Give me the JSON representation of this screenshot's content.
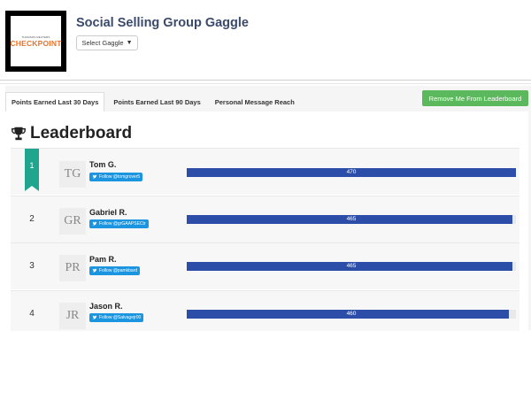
{
  "header": {
    "logo_small_text": "THOMSON REUTERS",
    "logo_main_text": "CHECKPOINT",
    "title": "Social Selling Group Gaggle",
    "select_label": "Select Gaggle"
  },
  "tabs": [
    {
      "label": "Points Earned Last 30 Days",
      "active": true
    },
    {
      "label": "Points Earned Last 90 Days",
      "active": false
    },
    {
      "label": "Personal Message Reach",
      "active": false
    }
  ],
  "remove_button_label": "Remove Me From Leaderboard",
  "leaderboard": {
    "title": "Leaderboard",
    "max_points": 470,
    "entries": [
      {
        "rank": "1",
        "initials": "TG",
        "name": "Tom G.",
        "follow": "Follow @tomgrover5",
        "points": 470,
        "points_label": "470"
      },
      {
        "rank": "2",
        "initials": "GR",
        "name": "Gabriel R.",
        "follow": "Follow @grGAAPSECtr",
        "points": 465,
        "points_label": "465"
      },
      {
        "rank": "3",
        "initials": "PR",
        "name": "Pam R.",
        "follow": "Follow @pamkbard",
        "points": 465,
        "points_label": "465"
      },
      {
        "rank": "4",
        "initials": "JR",
        "name": "Jason R.",
        "follow": "Follow @Salvagejr00",
        "points": 460,
        "points_label": "460"
      }
    ]
  },
  "colors": {
    "accent_bar": "#2c4ea8",
    "remove_button": "#5cb85c",
    "ribbon": "#20a58e",
    "twitter": "#1b95e0"
  }
}
